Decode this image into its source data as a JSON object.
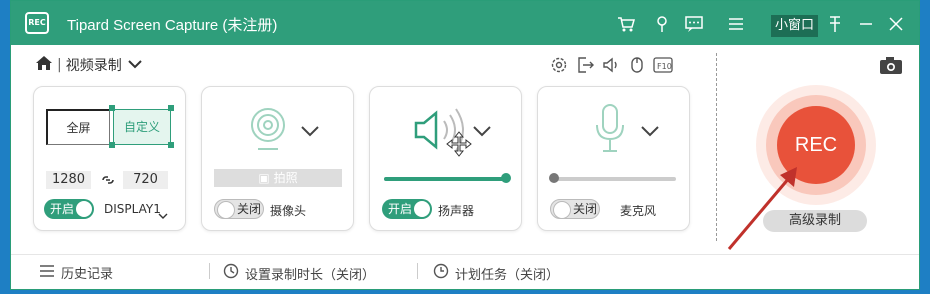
{
  "app": {
    "title": "Tipard Screen Capture (未注册)",
    "logo": "REC",
    "mini_window": "小窗口"
  },
  "nav": {
    "mode": "视频录制"
  },
  "screen_card": {
    "fullscreen": "全屏",
    "custom": "自定义",
    "width": "1280",
    "height": "720",
    "toggle": "开启",
    "display": "DISPLAY1"
  },
  "camera_card": {
    "snapshot": "拍照",
    "toggle": "关闭",
    "label": "摄像头"
  },
  "speaker_card": {
    "toggle": "开启",
    "label": "扬声器",
    "volume": 1.0
  },
  "mic_card": {
    "toggle": "关闭",
    "label": "麦克风",
    "volume": 0.0
  },
  "record": {
    "button": "REC",
    "advanced": "高级录制"
  },
  "footer": {
    "history": "历史记录",
    "duration": "设置录制时长（关闭）",
    "schedule": "计划任务（关闭）"
  },
  "toolbar_icons": [
    "settings-icon",
    "export-icon",
    "volume-icon",
    "mouse-icon",
    "f10-icon"
  ],
  "colors": {
    "accent": "#2f9e7b",
    "rec": "#e8523a"
  }
}
